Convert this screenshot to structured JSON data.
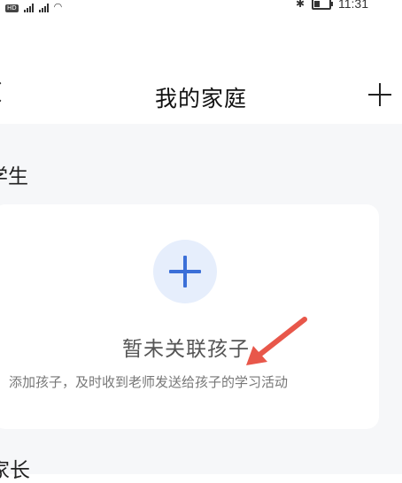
{
  "status_bar": {
    "network_label": "HD",
    "time": "11:31"
  },
  "header": {
    "title": "我的家庭"
  },
  "sections": {
    "students_title": "学生",
    "parents_title": "家长"
  },
  "empty_state": {
    "title": "暂未关联孩子",
    "subtitle": "添加孩子，及时收到老师发送给孩子的学习活动"
  },
  "colors": {
    "accent": "#3b6fd8",
    "accent_bg": "#e6eefc",
    "arrow": "#e8574a",
    "page_bg": "#f6f7f9"
  }
}
